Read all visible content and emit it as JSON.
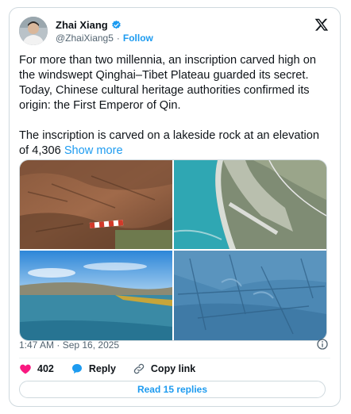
{
  "author": {
    "name": "Zhai Xiang",
    "handle": "@ZhaiXiang5",
    "separator": "·",
    "follow_label": "Follow"
  },
  "post": {
    "paragraph1": "For more than two millennia, an inscription carved high on the windswept Qinghai–Tibet Plateau guarded its secret. Today, Chinese cultural heritage authorities confirmed its origin: the First Emperor of Qin.",
    "paragraph2": "The inscription is carved on a lakeside rock at an elevation of 4,306",
    "show_more": "Show more",
    "timestamp": "1:47 AM · Sep 16, 2025"
  },
  "actions": {
    "like_count": "402",
    "reply_label": "Reply",
    "copy_link_label": "Copy link",
    "read_replies_label": "Read 15 replies"
  },
  "colors": {
    "accent": "#1d9bf0",
    "like": "#f91880",
    "muted": "#536471"
  }
}
